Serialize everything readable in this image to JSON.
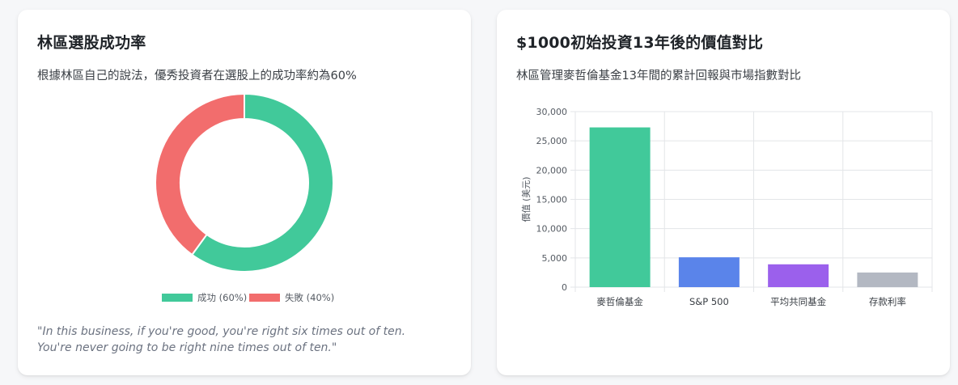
{
  "left_card": {
    "title": "林區選股成功率",
    "subtitle": "根據林區自己的說法，優秀投資者在選股上的成功率約為60%",
    "quote": "\"In this business, if you're good, you're right six times out of ten. You're never going to be right nine times out of ten.\""
  },
  "right_card": {
    "title": "$1000初始投資13年後的價值對比",
    "subtitle": "林區管理麥哲倫基金13年間的累計回報與市場指數對比"
  },
  "chart_data": [
    {
      "type": "pie",
      "variant": "doughnut",
      "categories": [
        "成功 (60%)",
        "失敗 (40%)"
      ],
      "values": [
        60,
        40
      ],
      "colors": [
        "#41c99a",
        "#f26d6d"
      ],
      "legend": "bottom"
    },
    {
      "type": "bar",
      "categories": [
        "麥哲倫基金",
        "S&P 500",
        "平均共同基金",
        "存款利率"
      ],
      "values": [
        27300,
        5100,
        3900,
        2500
      ],
      "colors": [
        "#41c99a",
        "#5a84ea",
        "#9b60ec",
        "#b3b8c2"
      ],
      "ylabel": "價值 (美元)",
      "ylim": [
        0,
        30000
      ],
      "yticks": [
        "0",
        "5,000",
        "10,000",
        "15,000",
        "20,000",
        "25,000",
        "30,000"
      ],
      "grid": true
    }
  ]
}
